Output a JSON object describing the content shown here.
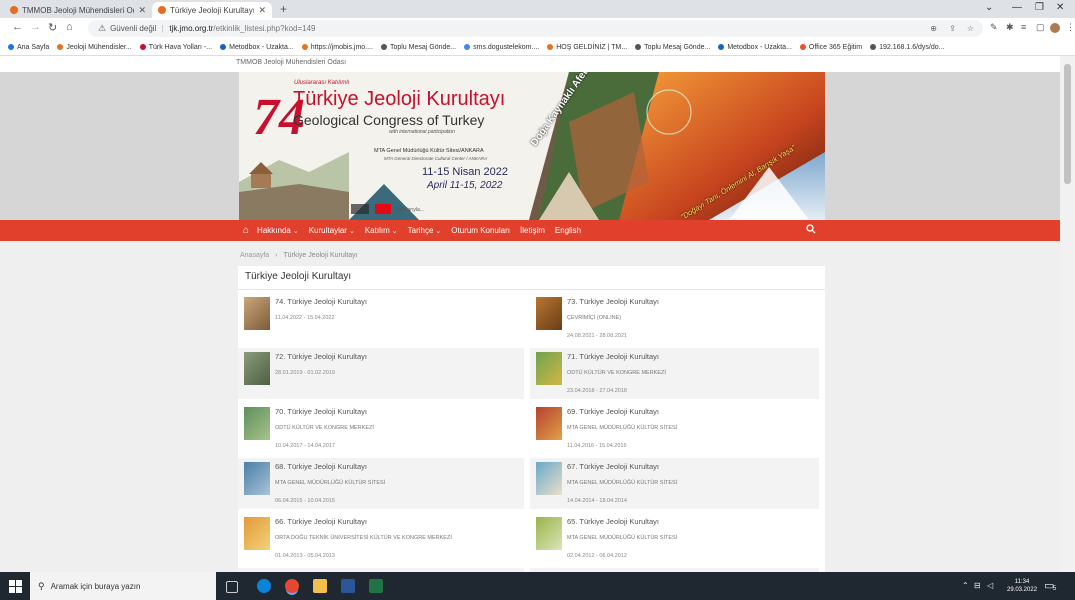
{
  "browser": {
    "tabs": [
      {
        "title": "TMMOB Jeoloji Mühendisleri Oda",
        "active": false
      },
      {
        "title": "Türkiye Jeoloji Kurultayı | TMMO",
        "active": true
      }
    ],
    "security_label": "Güvenli değil",
    "url_host": "tjk.jmo.org.tr",
    "url_path": "/etkinlik_listesi.php?kod=149",
    "bookmarks": [
      {
        "label": "Ana Sayfa",
        "color": "#1a73e8"
      },
      {
        "label": "Jeoloji Mühendisler...",
        "color": "#e8711a"
      },
      {
        "label": "Türk Hava Yolları -...",
        "color": "#c8102e"
      },
      {
        "label": "Metodbox - Uzakta...",
        "color": "#1565c0"
      },
      {
        "label": "https://jmobis.jmo....",
        "color": "#e8711a"
      },
      {
        "label": "Toplu Mesaj Gönde...",
        "color": "#555555"
      },
      {
        "label": "sms.dogustelekom....",
        "color": "#4285f4"
      },
      {
        "label": "HOŞ GELDİNİZ | TM...",
        "color": "#e8711a"
      },
      {
        "label": "Toplu Mesaj Gönde...",
        "color": "#555555"
      },
      {
        "label": "Metodbox - Uzakta...",
        "color": "#1565c0"
      },
      {
        "label": "Office 365 Eğitim",
        "color": "#f25022"
      },
      {
        "label": "192.168.1.6/dys/do...",
        "color": "#555555"
      }
    ]
  },
  "site": {
    "org_label": "TMMOB Jeoloji Mühendisleri Odası",
    "banner": {
      "number": "74",
      "title_tr": "Türkiye Jeoloji Kurultayı",
      "title_en": "Geological Congress of Turkey",
      "with_participation": "with international participation",
      "venue_tr": "MTA Genel Müdürlüğü Kültür Sitesi/ANKARA",
      "venue_en": "MTA General Directorate Cultural Center / ANKARA",
      "dates_tr": "11-15 Nisan 2022",
      "dates_en": "April 11-15, 2022",
      "slogan_top": "Doğa Kaynaklı Afetler",
      "slogan_bottom": "\"Doğayı Tanı, Önlemini Al, Barışık Yaşa\"",
      "supporters": "Katkılarıyla..."
    },
    "menu": [
      {
        "label": "Hakkında",
        "has_dropdown": true
      },
      {
        "label": "Kurultaylar",
        "has_dropdown": true
      },
      {
        "label": "Katılım",
        "has_dropdown": true
      },
      {
        "label": "Tarihçe",
        "has_dropdown": true
      },
      {
        "label": "Oturum Konuları",
        "has_dropdown": false
      },
      {
        "label": "İletişim",
        "has_dropdown": false
      },
      {
        "label": "English",
        "has_dropdown": false
      }
    ],
    "breadcrumb": {
      "home": "Anasayfa",
      "current": "Türkiye Jeoloji Kurultayı"
    },
    "list_title": "Türkiye Jeoloji Kurultayı",
    "items": [
      {
        "title": "74. Türkiye Jeoloji Kurultayı",
        "place": "",
        "dates": "11.04.2022 - 15.04.2022",
        "thumb_color": "#c9a77a"
      },
      {
        "title": "73. Türkiye Jeoloji Kurultayı",
        "place": "ÇEVRİMİÇİ (ONLINE)",
        "dates": "24.08.2021 - 28.08.2021",
        "thumb_color": "#b8762f"
      },
      {
        "title": "72. Türkiye Jeoloji Kurultayı",
        "place": "",
        "dates": "28.01.2019 - 01.02.2019",
        "thumb_color": "#8a9c78"
      },
      {
        "title": "71. Türkiye Jeoloji Kurultayı",
        "place": "ODTÜ KÜLTÜR VE KONGRE MERKEZİ",
        "dates": "23.04.2018 - 27.04.2018",
        "thumb_color": "#6fa34f"
      },
      {
        "title": "70. Türkiye Jeoloji Kurultayı",
        "place": "ODTÜ KÜLTÜR VE KONGRE MERKEZİ",
        "dates": "10.04.2017 - 14.04.2017",
        "thumb_color": "#5f8f5a"
      },
      {
        "title": "69. Türkiye Jeoloji Kurultayı",
        "place": "MTA GENEL MÜDÜRLÜĞÜ KÜLTÜR SİTESİ",
        "dates": "11.04.2016 - 15.04.2016",
        "thumb_color": "#b5412e"
      },
      {
        "title": "68. Türkiye Jeoloji Kurultayı",
        "place": "MTA GENEL MÜDÜRLÜĞÜ KÜLTÜR SİTESİ",
        "dates": "06.04.2015 - 10.04.2015",
        "thumb_color": "#4a7fa8"
      },
      {
        "title": "67. Türkiye Jeoloji Kurultayı",
        "place": "MTA GENEL MÜDÜRLÜĞÜ KÜLTÜR SİTESİ",
        "dates": "14.04.2014 - 18.04.2014",
        "thumb_color": "#6aa7c9"
      },
      {
        "title": "66. Türkiye Jeoloji Kurultayı",
        "place": "ORTA DOĞU TEKNİK ÜNİVERSİTESİ KÜLTÜR VE KONGRE MERKEZİ",
        "dates": "01.04.2013 - 05.04.2013",
        "thumb_color": "#e29a3a"
      },
      {
        "title": "65. Türkiye Jeoloji Kurultayı",
        "place": "MTA GENEL MÜDÜRLÜĞÜ KÜLTÜR SİTESİ",
        "dates": "02.04.2012 - 06.04.2012",
        "thumb_color": "#9bb34a"
      }
    ]
  },
  "taskbar": {
    "search_placeholder": "Aramak için buraya yazın",
    "time": "11:34",
    "date": "29.03.2022",
    "notifications": "5"
  }
}
